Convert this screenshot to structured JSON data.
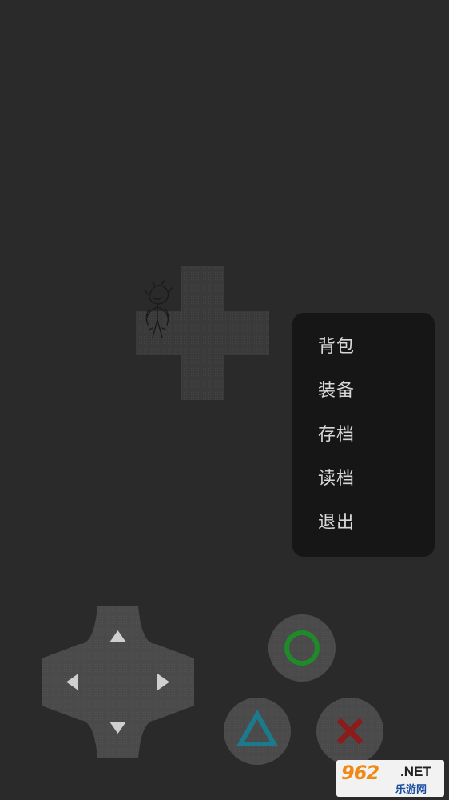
{
  "menu": {
    "items": [
      {
        "label": "背包"
      },
      {
        "label": "装备"
      },
      {
        "label": "存档"
      },
      {
        "label": "读档"
      },
      {
        "label": "退出"
      }
    ]
  },
  "controls": {
    "dpad_icons": [
      "arrow-up-icon",
      "arrow-left-icon",
      "arrow-right-icon",
      "arrow-down-icon"
    ],
    "action_buttons": [
      {
        "name": "circle",
        "color": "#1e8a2a"
      },
      {
        "name": "triangle",
        "color": "#1b7a8c"
      },
      {
        "name": "cross",
        "color": "#8c1b1b"
      }
    ]
  },
  "watermark": {
    "brand": "962",
    "suffix": ".NET",
    "cn": "乐游网"
  },
  "colors": {
    "background": "#2a2a2a",
    "menu_bg": "#161616",
    "menu_text": "#d8d8d8",
    "map_floor": "#3a3a3a",
    "button_bg": "#4a4a4a"
  }
}
